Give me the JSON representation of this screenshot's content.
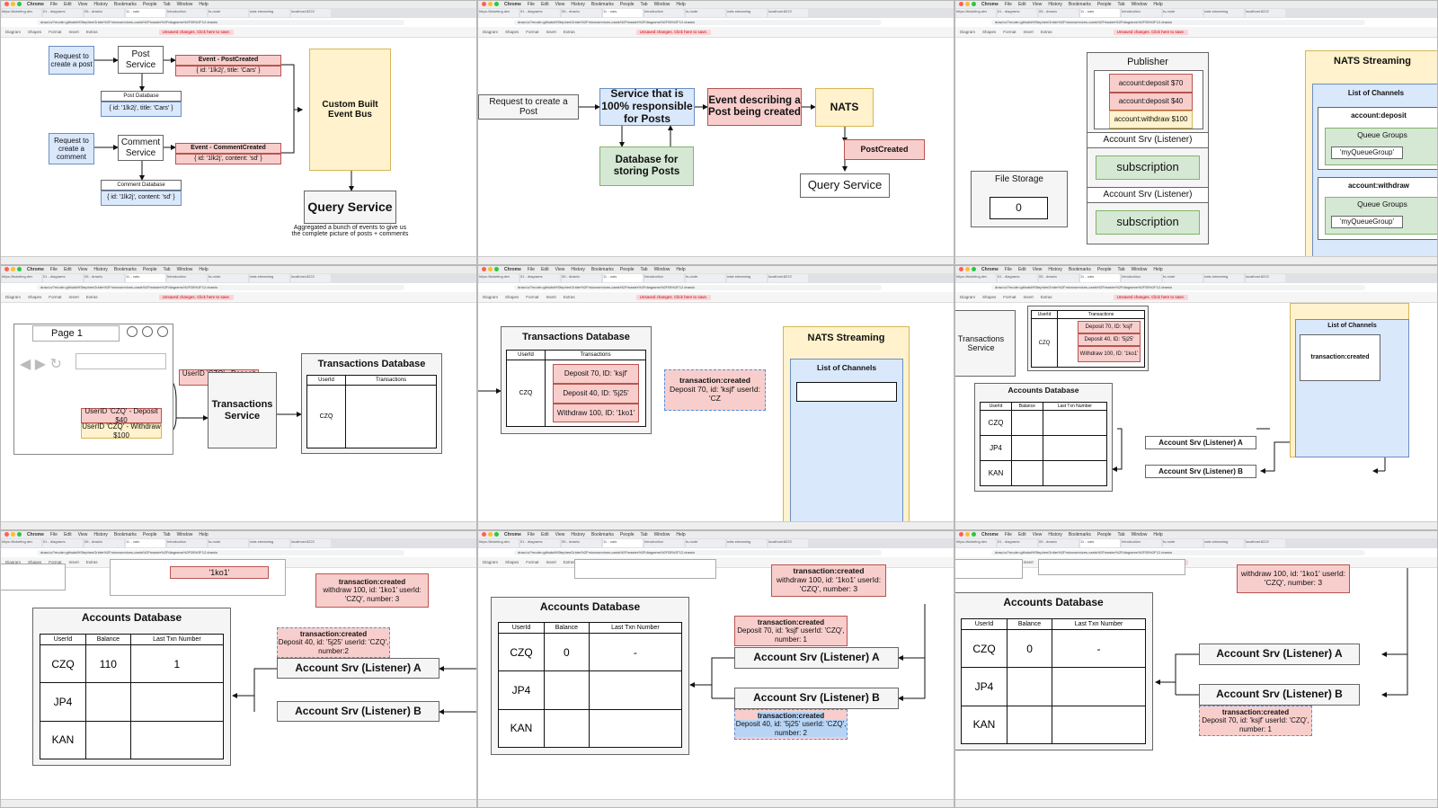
{
  "browser": {
    "app": "Chrome",
    "menus": [
      "File",
      "Edit",
      "View",
      "History",
      "Bookmarks",
      "People",
      "Tab",
      "Window",
      "Help"
    ],
    "tabs": [
      "https://ticketing.dev",
      "01 - diagrams",
      "05 - drawio",
      "11 - nats",
      "Introduction",
      "ts-node",
      "nats streaming",
      "localhost:8222"
    ],
    "url": "draw.io/?mode=github#HStephenGrider%2Fmicroservices-casts%2Fmaster%2Fdiagrams%2F05%2F12.drawio",
    "toolbar": [
      "Diagram",
      "Shapes",
      "Format",
      "Insert",
      "Extras"
    ],
    "unsaved": "Unsaved changes. Click here to save."
  },
  "colors": {
    "blue": "#dae8fc",
    "red": "#f8cecc",
    "yellow": "#fff2cc",
    "green": "#d5e8d4",
    "gray": "#f5f5f5"
  },
  "p1": {
    "req_post": "Request to create a post",
    "post_service": "Post Service",
    "post_db": "Post Database",
    "post_db_row": "{ id: '1lk2j', title: 'Cars' }",
    "ev_post": "Event - PostCreated",
    "ev_post_body": "{ id: '1lk2j', title: 'Cars' }",
    "req_comment": "Request to create a comment",
    "comment_service": "Comment Service",
    "comment_db": "Comment Database",
    "comment_db_row": "{ id: '1lk2j', content: 'sd' }",
    "ev_comment": "Event - CommentCreated",
    "ev_comment_body": "{ id: '1lk2j', content: 'sd' }",
    "bus": "Custom Built Event Bus",
    "query": "Query Service",
    "note": "Aggregated a bunch of events to give us the complete picture of posts + comments"
  },
  "p2": {
    "req": "Request to create a Post",
    "service": "Service that is 100% responsible for Posts",
    "event": "Event describing a Post being created",
    "nats": "NATS",
    "db": "Database for storing Posts",
    "post_created": "PostCreated",
    "query": "Query Service"
  },
  "p3": {
    "publisher": "Publisher",
    "items": [
      "account:deposit $70",
      "account:deposit $40",
      "account:withdraw $100"
    ],
    "listener_a": "Account Srv (Listener)",
    "listener_b": "Account Srv (Listener)",
    "subscription": "subscription",
    "file_storage": "File Storage",
    "file_value": "0",
    "nats_streaming": "NATS Streaming",
    "list_of_channels": "List of Channels",
    "ch_deposit": "account:deposit",
    "ch_withdraw": "account:withdraw",
    "queue_groups": "Queue Groups",
    "queue_name": "'myQueueGroup'"
  },
  "p4": {
    "page": "Page 1",
    "ev1": "UserID 'CZQ' - Deposit $70",
    "ev2": "UserID 'CZQ' - Deposit $40",
    "ev3": "UserID 'CZQ' - Withdraw $100",
    "service": "Transactions Service",
    "db_title": "Transactions Database",
    "cols": [
      "UserId",
      "Transactions"
    ],
    "user": "CZQ"
  },
  "p5": {
    "db_title": "Transactions Database",
    "cols": [
      "UserId",
      "Transactions"
    ],
    "user": "CZQ",
    "txns": [
      "Deposit 70, ID: 'ksjf'",
      "Deposit 40, ID: '5j25'",
      "Withdraw 100, ID: '1ko1'"
    ],
    "event_title": "transaction:created",
    "event_body": "Deposit 70, id: 'ksjf' userId: 'CZ",
    "nats": "NATS Streaming",
    "list_of_channels": "List of Channels"
  },
  "p6": {
    "service": "Transactions Service",
    "user": "CZQ",
    "txn_col": "Transactions",
    "txns": [
      "Deposit 70, ID: 'ksjf'",
      "Deposit 40, ID: '5j25'",
      "Withdraw 100, ID: '1ko1'"
    ],
    "accounts_title": "Accounts Database",
    "cols": [
      "UserId",
      "Balance",
      "Last Txn Number"
    ],
    "users": [
      "CZQ",
      "JP4",
      "KAN"
    ],
    "listener_a": "Account Srv (Listener) A",
    "listener_b": "Account Srv (Listener) B",
    "list_of_channels": "List of Channels",
    "channel": "transaction:created"
  },
  "p7": {
    "top_txn": "'1ko1'",
    "ev_top_title": "transaction:created",
    "ev_top_body": "withdraw 100, id: '1ko1' userId: 'CZQ', number: 3",
    "accounts_title": "Accounts Database",
    "cols": [
      "UserId",
      "Balance",
      "Last Txn Number"
    ],
    "rows": [
      [
        "CZQ",
        "110",
        "1"
      ],
      [
        "JP4",
        "",
        ""
      ],
      [
        "KAN",
        "",
        ""
      ]
    ],
    "ev_mid_title": "transaction:created",
    "ev_mid_body": "Deposit 40, id: '5j25' userId: 'CZQ', number:2",
    "listener_a": "Account Srv (Listener) A",
    "listener_b": "Account Srv (Listener) B"
  },
  "p8": {
    "ev_top_title": "transaction:created",
    "ev_top_body": "withdraw 100, id: '1ko1' userId: 'CZQ', number: 3",
    "accounts_title": "Accounts Database",
    "cols": [
      "UserId",
      "Balance",
      "Last Txn Number"
    ],
    "rows": [
      [
        "CZQ",
        "0",
        "-"
      ],
      [
        "JP4",
        "",
        ""
      ],
      [
        "KAN",
        "",
        ""
      ]
    ],
    "ev_a_title": "transaction:created",
    "ev_a_body": "Deposit 70, id: 'ksjf' userId: 'CZQ', number: 1",
    "listener_a": "Account Srv (Listener) A",
    "listener_b": "Account Srv (Listener) B",
    "ev_b_title": "transaction:created",
    "ev_b_body": "Deposit 40, id: '5j25' userId: 'CZQ', number: 2"
  },
  "p9": {
    "ev_top_body": "withdraw 100, id: '1ko1' userId: 'CZQ', number: 3",
    "accounts_title": "Accounts Database",
    "cols": [
      "UserId",
      "Balance",
      "Last Txn Number"
    ],
    "rows": [
      [
        "CZQ",
        "0",
        "-"
      ],
      [
        "JP4",
        "",
        ""
      ],
      [
        "KAN",
        "",
        ""
      ]
    ],
    "listener_a": "Account Srv (Listener) A",
    "listener_b": "Account Srv (Listener) B",
    "ev_b_title": "transaction:created",
    "ev_b_body": "Deposit 70, id: 'ksjf' userId: 'CZQ', number: 1"
  }
}
